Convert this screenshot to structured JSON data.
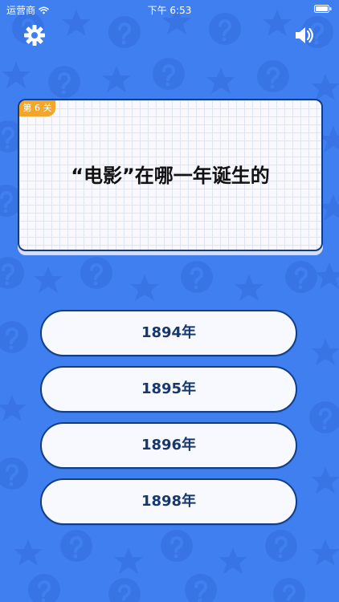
{
  "status_bar": {
    "carrier": "运营商",
    "time": "下午 6:53"
  },
  "controls": {
    "settings_icon": "gear-icon",
    "sound_icon": "speaker-icon"
  },
  "question": {
    "level": "第 6 关",
    "text": "“电影”在哪一年诞生的"
  },
  "answers": [
    "1894年",
    "1895年",
    "1896年",
    "1898年"
  ],
  "colors": {
    "background": "#3f7ff0",
    "pattern": "#2f67d4",
    "outline": "#123d87",
    "card_bg": "#f8f8fd",
    "tag": "#f2a728",
    "answer_text": "#17376d"
  }
}
